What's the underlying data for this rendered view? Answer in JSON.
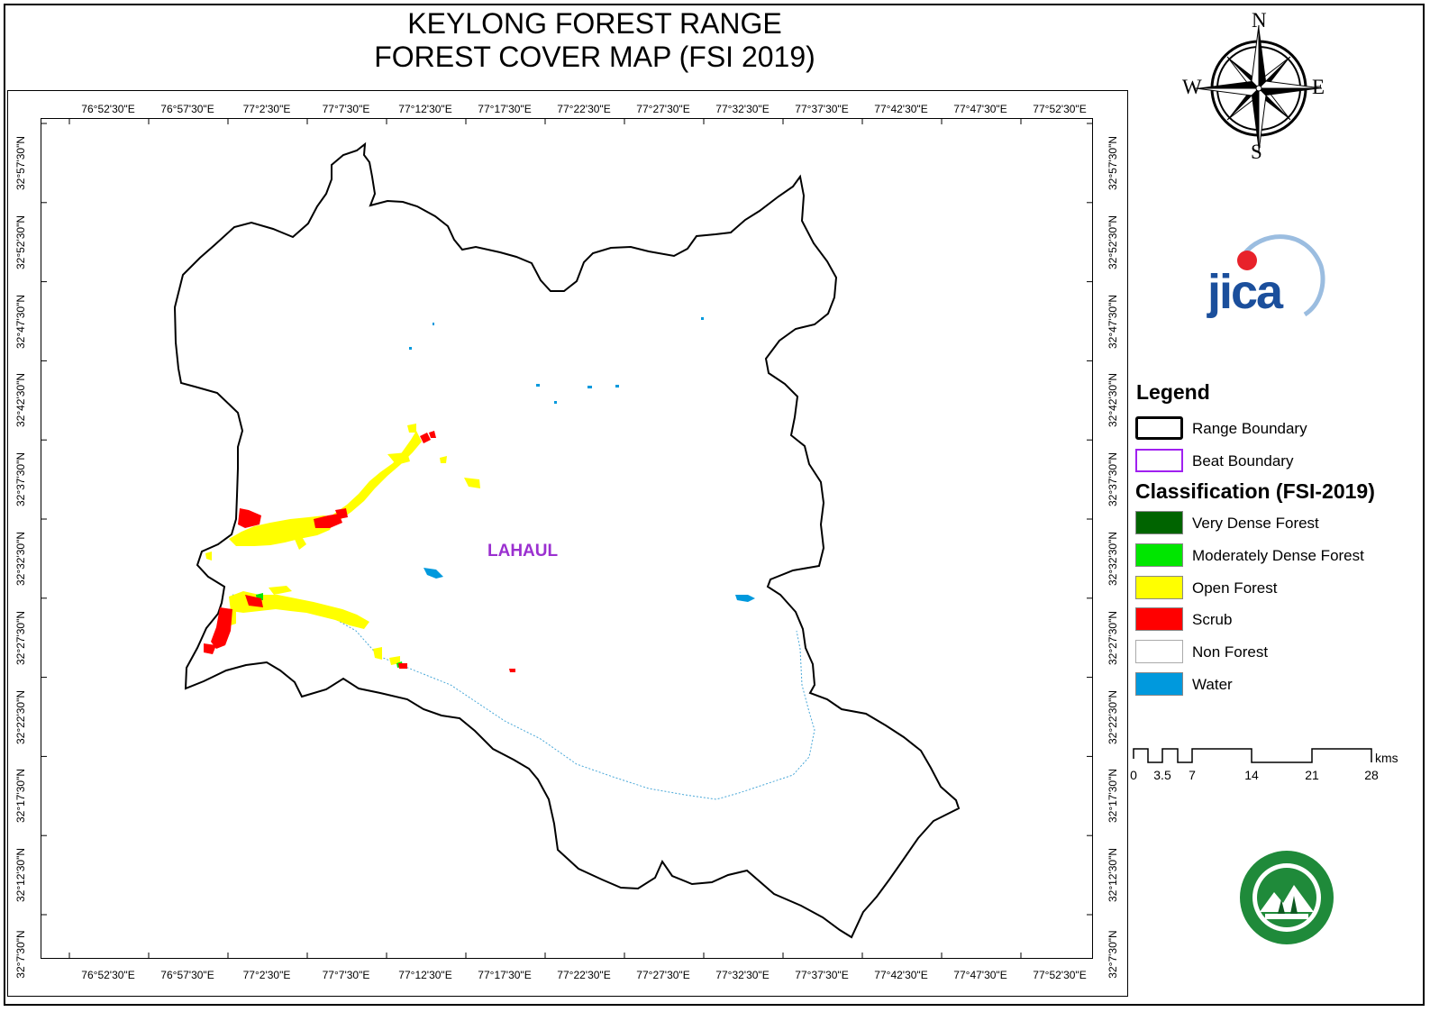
{
  "title": {
    "line1": "KEYLONG FOREST RANGE",
    "line2": "FOREST COVER MAP (FSI 2019)"
  },
  "map": {
    "region_label": "LAHAUL",
    "longitude_ticks": [
      "76°52'30\"E",
      "76°57'30\"E",
      "77°2'30\"E",
      "77°7'30\"E",
      "77°12'30\"E",
      "77°17'30\"E",
      "77°22'30\"E",
      "77°27'30\"E",
      "77°32'30\"E",
      "77°37'30\"E",
      "77°42'30\"E",
      "77°47'30\"E",
      "77°52'30\"E"
    ],
    "latitude_ticks": [
      "32°57'30\"N",
      "32°52'30\"N",
      "32°47'30\"N",
      "32°42'30\"N",
      "32°37'30\"N",
      "32°32'30\"N",
      "32°27'30\"N",
      "32°22'30\"N",
      "32°17'30\"N",
      "32°12'30\"N",
      "32°7'30\"N"
    ]
  },
  "compass": {
    "north": "N",
    "south": "S",
    "east": "E",
    "west": "W"
  },
  "logos": {
    "jica": "jica"
  },
  "legend": {
    "title": "Legend",
    "boundaries": [
      {
        "label": "Range Boundary",
        "color": "#000000"
      },
      {
        "label": "Beat Boundary",
        "color": "#a020f0"
      }
    ],
    "classification_title": "Classification (FSI-2019)",
    "classes": [
      {
        "label": "Very Dense Forest",
        "color": "#006400"
      },
      {
        "label": "Moderately Dense Forest",
        "color": "#00e600"
      },
      {
        "label": "Open Forest",
        "color": "#ffff00"
      },
      {
        "label": "Scrub",
        "color": "#ff0000"
      },
      {
        "label": "Non Forest",
        "color": "#ffffff"
      },
      {
        "label": "Water",
        "color": "#0099dd"
      }
    ]
  },
  "scale_bar": {
    "unit": "kms",
    "labels": [
      "0",
      "3.5",
      "7",
      "14",
      "21",
      "28"
    ]
  }
}
